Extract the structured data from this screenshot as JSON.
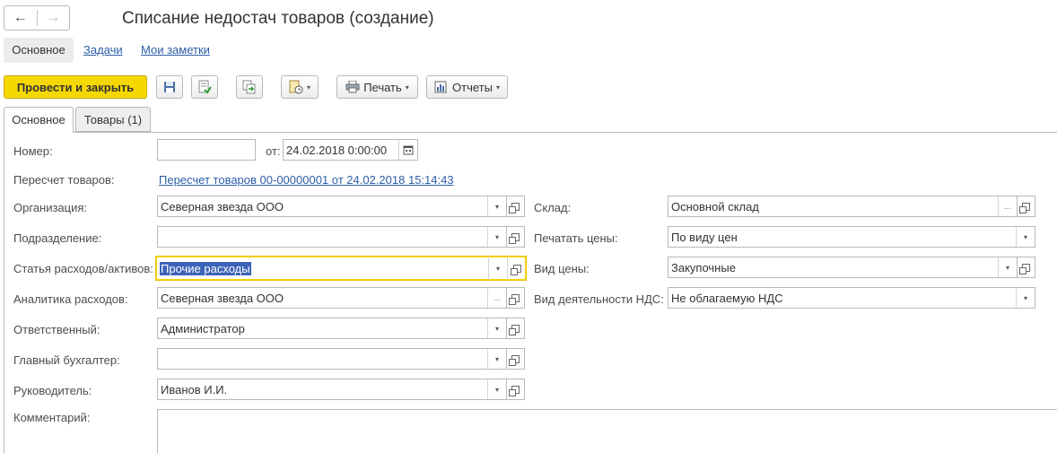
{
  "window": {
    "title": "Списание недостач товаров (создание)"
  },
  "nav": {
    "back_icon": "arrow-left-icon",
    "forward_icon": "arrow-right-icon"
  },
  "top_tabs": [
    {
      "label": "Основное"
    },
    {
      "label": "Задачи"
    },
    {
      "label": "Мои заметки"
    }
  ],
  "toolbar": {
    "post_close_label": "Провести и закрыть",
    "print_label": "Печать",
    "reports_label": "Отчеты"
  },
  "form_tabs": [
    {
      "label": "Основное"
    },
    {
      "label": "Товары (1)"
    }
  ],
  "form": {
    "number": {
      "label": "Номер:",
      "value": ""
    },
    "date": {
      "label": "от:",
      "value": "24.02.2018  0:00:00"
    },
    "recount": {
      "label": "Пересчет товаров:",
      "value": "Пересчет товаров 00-00000001 от 24.02.2018 15:14:43"
    },
    "organization": {
      "label": "Организация:",
      "value": "Северная звезда ООО"
    },
    "department": {
      "label": "Подразделение:",
      "value": ""
    },
    "expense_item": {
      "label": "Статья расходов/активов:",
      "value": "Прочие расходы"
    },
    "expense_analytics": {
      "label": "Аналитика расходов:",
      "value": "Северная звезда ООО"
    },
    "responsible": {
      "label": "Ответственный:",
      "value": "Администратор"
    },
    "chief_accountant": {
      "label": "Главный бухгалтер:",
      "value": ""
    },
    "manager": {
      "label": "Руководитель:",
      "value": "Иванов И.И."
    },
    "comment": {
      "label": "Комментарий:",
      "value": ""
    },
    "warehouse": {
      "label": "Склад:",
      "value": "Основной склад"
    },
    "print_prices": {
      "label": "Печатать цены:",
      "value": "По виду цен"
    },
    "price_type": {
      "label": "Вид цены:",
      "value": "Закупочные"
    },
    "vat_activity": {
      "label": "Вид деятельности НДС:",
      "value": "Не облагаемую НДС"
    }
  },
  "colors": {
    "accent": "#f5d800",
    "link": "#2d5ea8",
    "selection": "#3d63b8"
  }
}
